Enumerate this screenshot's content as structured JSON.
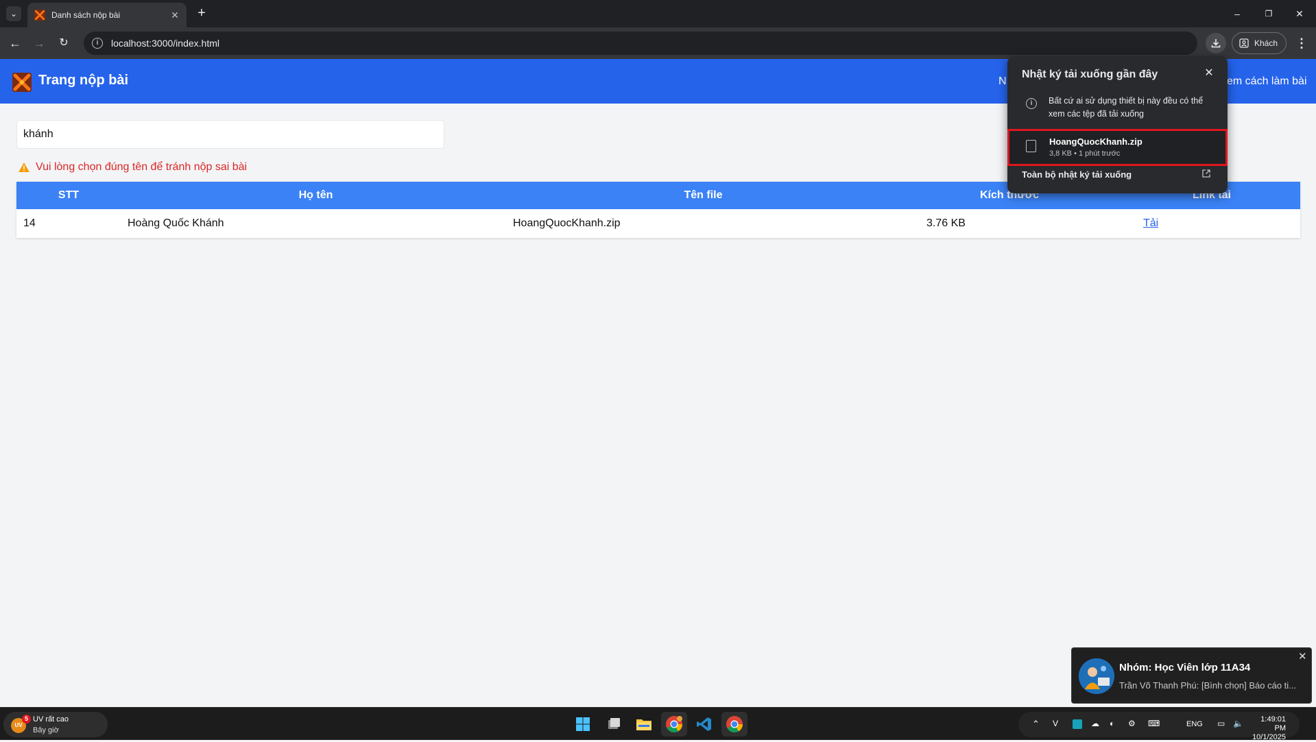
{
  "browser": {
    "tab_title": "Danh sách nộp bài",
    "url": "localhost:3000/index.html",
    "profile_label": "Khách"
  },
  "page": {
    "title": "Trang nộp bài",
    "nav_left_partial": "N",
    "nav_right_partial": "em cách làm bài",
    "search_value": "khánh",
    "warning": "Vui lòng chọn đúng tên để tránh nộp sai bài",
    "table": {
      "headers": [
        "STT",
        "Họ tên",
        "Tên file",
        "Kích thước",
        "Link tải"
      ],
      "rows": [
        {
          "stt": "14",
          "name": "Hoàng Quốc Khánh",
          "file": "HoangQuocKhanh.zip",
          "size": "3.76 KB",
          "link": "Tải"
        }
      ]
    }
  },
  "download_popup": {
    "title": "Nhật ký tải xuống gần đây",
    "info": "Bất cứ ai sử dụng thiết bị này đều có thể xem các tệp đã tải xuống",
    "item": {
      "name": "HoangQuocKhanh.zip",
      "meta": "3,8 KB • 1 phút trước"
    },
    "all_history": "Toàn bộ nhật ký tải xuống"
  },
  "toast": {
    "title": "Nhóm: Học Viên lớp 11A34",
    "body": "Trần Võ Thanh Phú: [Bình chọn] Báo cáo ti..."
  },
  "taskbar": {
    "weather_line1": "UV rất cao",
    "weather_line2": "Bây giờ",
    "weather_icon_text": "UV",
    "weather_badge": "5",
    "lang": "ENG",
    "time": "1:49:01 PM",
    "date": "10/1/2025"
  },
  "colors": {
    "header_blue": "#2563eb",
    "table_header_blue": "#3b82f6",
    "warning_red": "#dc2626",
    "highlight_red": "#e0161e"
  }
}
